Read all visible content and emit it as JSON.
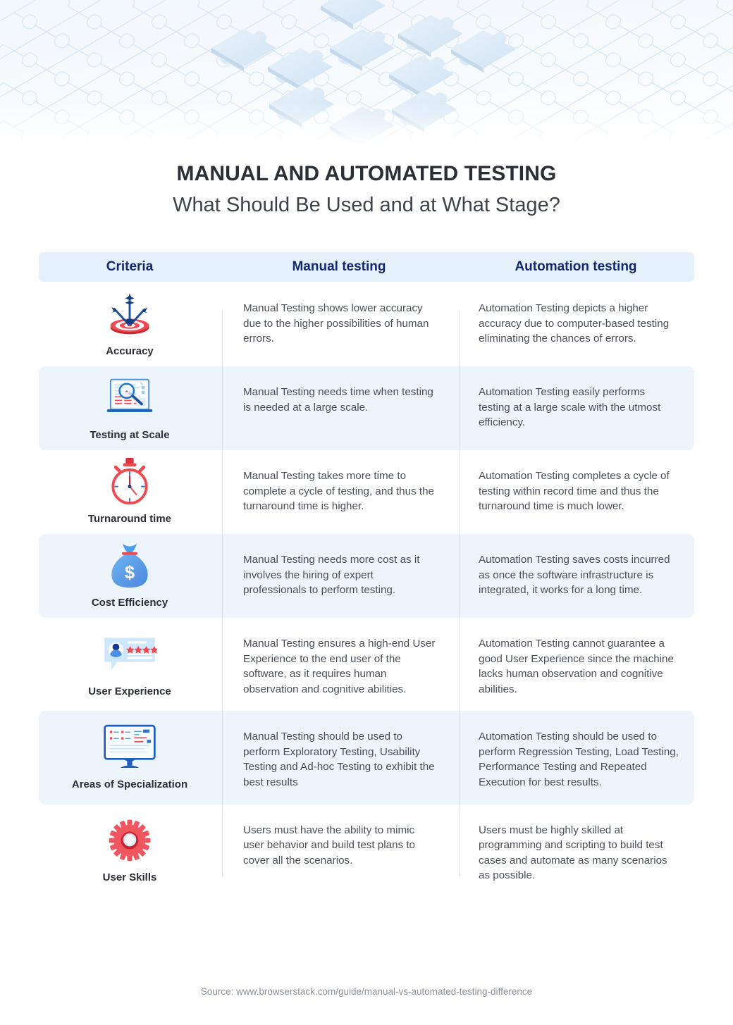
{
  "header": {
    "title": "MANUAL AND AUTOMATED TESTING",
    "subtitle": "What Should Be Used and at What Stage?"
  },
  "table": {
    "columns": {
      "criteria": "Criteria",
      "manual": "Manual testing",
      "automation": "Automation testing"
    },
    "rows": [
      {
        "icon": "target-arrows-icon",
        "criteria": "Accuracy",
        "manual": "Manual Testing shows lower accuracy due to the higher possibilities of human errors.",
        "automation": "Automation Testing depicts a higher accuracy due to computer-based testing eliminating the chances of errors."
      },
      {
        "icon": "laptop-magnifier-icon",
        "criteria": "Testing at Scale",
        "manual": "Manual Testing needs time when testing is needed at a large scale.",
        "automation": "Automation Testing easily performs testing at a large scale with the utmost efficiency."
      },
      {
        "icon": "stopwatch-icon",
        "criteria": "Turnaround time",
        "manual": "Manual Testing takes more time to complete a cycle of testing, and thus the turnaround time is higher.",
        "automation": "Automation Testing completes a cycle of testing within record time and thus the turnaround time is much lower."
      },
      {
        "icon": "money-bag-icon",
        "criteria": "Cost Efficiency",
        "manual": "Manual Testing needs more cost as it involves the hiring of expert professionals to perform testing.",
        "automation": "Automation Testing saves costs incurred as once the software infrastructure is integrated, it works for a long time."
      },
      {
        "icon": "review-bubble-stars-icon",
        "criteria": "User Experience",
        "manual": "Manual Testing ensures a high-end User Experience to the end user of the software, as it requires human observation and cognitive abilities.",
        "automation": "Automation Testing cannot guarantee a good User Experience since the machine lacks human observation and cognitive abilities."
      },
      {
        "icon": "desktop-monitor-icon",
        "criteria": "Areas of Specialization",
        "manual": "Manual Testing should be used to perform Exploratory Testing, Usability Testing and Ad-hoc Testing to exhibit the best results",
        "automation": "Automation Testing should be used to perform Regression Testing, Load Testing, Performance Testing and Repeated Execution for best results."
      },
      {
        "icon": "gear-icon",
        "criteria": "User Skills",
        "manual": "Users must have the ability to mimic user behavior and build test plans to cover all the scenarios.",
        "automation": "Users must be highly skilled at programming and scripting to build test cases and automate as many scenarios as possible."
      }
    ]
  },
  "footer": {
    "source": "Source: www.browserstack.com/guide/manual-vs-automated-testing-difference"
  },
  "colors": {
    "header_band": "#e4f0fa",
    "header_text": "#15276d",
    "row_shaded": "#edf4fb",
    "title": "#2b2e34",
    "body_text": "#4a4f57",
    "accent_red": "#ed3a45",
    "accent_blue": "#1b5fc1",
    "divider": "#d9e3ec"
  }
}
